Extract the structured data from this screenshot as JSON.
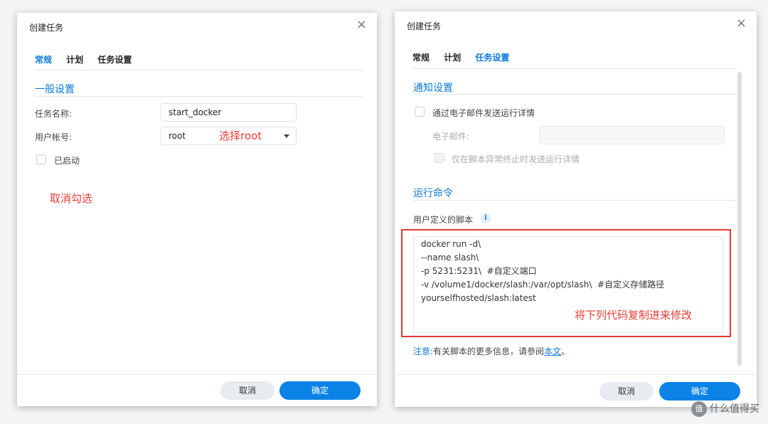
{
  "left_dialog": {
    "title": "创建任务",
    "close": "×",
    "tabs": [
      "常规",
      "计划",
      "任务设置"
    ],
    "section_title": "一般设置",
    "task_name_label": "任务名称:",
    "task_name_value": "start_docker",
    "user_label": "用户帐号:",
    "user_value": "root",
    "enabled_label": "已启动",
    "annotation_select": "选择root",
    "annotation_uncheck": "取消勾选",
    "cancel": "取消",
    "ok": "确定"
  },
  "right_dialog": {
    "title": "创建任务",
    "close": "×",
    "tabs": [
      "常规",
      "计划",
      "任务设置"
    ],
    "notify_title": "通知设置",
    "email_check_label": "通过电子邮件发送运行详情",
    "email_label": "电子邮件:",
    "abnormal_label": "仅在脚本异常终止时发送运行详情",
    "run_title": "运行命令",
    "script_label": "用户定义的脚本",
    "info_icon": "i",
    "code_lines": [
      "docker run -d\\",
      "--name slash\\",
      "-p 5231:5231\\  #自定义端口",
      "-v /volume1/docker/slash:/var/opt/slash\\  #自定义存储路径",
      "yourselfhosted/slash:latest"
    ],
    "annotation_copy": "将下列代码复制进来修改",
    "note_prefix": "注意",
    "note_text": ":有关脚本的更多信息，请参阅",
    "note_link": "本文",
    "note_end": "。",
    "cancel": "取消",
    "ok": "确定"
  },
  "watermark": {
    "badge": "值",
    "text": "什么值得买"
  }
}
